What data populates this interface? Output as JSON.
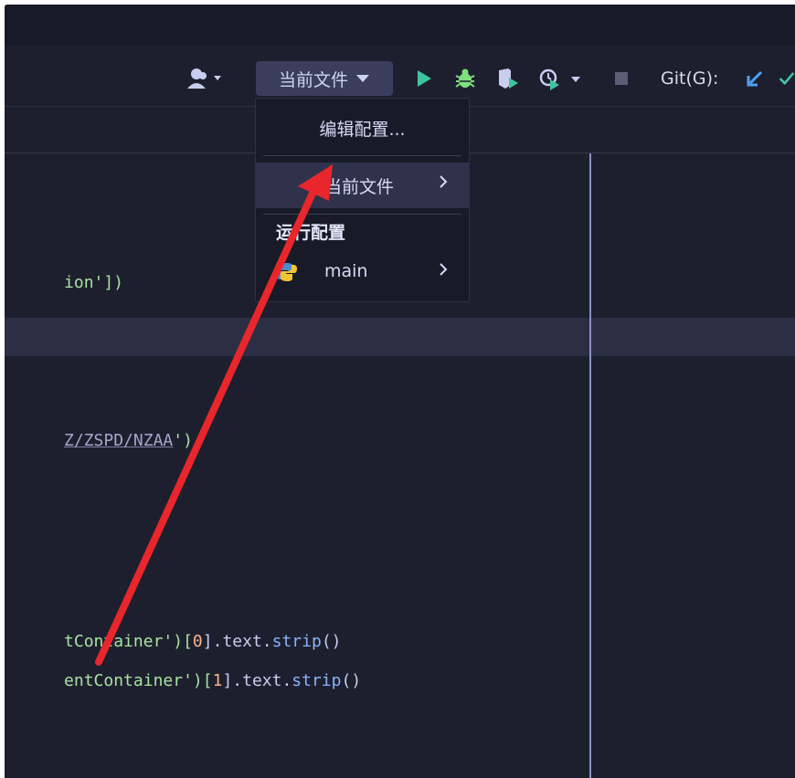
{
  "toolbar": {
    "run_config_label": "当前文件",
    "git_label": "Git(G):",
    "colors": {
      "run": "#40c4a0",
      "debug": "#7ee07e",
      "accent_blue": "#4ea2f5"
    }
  },
  "dropdown": {
    "edit_label": "编辑配置...",
    "current_file_label": "当前文件",
    "section_header": "运行配置",
    "main_label": "main"
  },
  "code": {
    "line1_tail": "ion'])",
    "line2_path": "Z/ZSPD/NZAA",
    "line2_tail": "')",
    "line3_a": "tContainer')[",
    "line3_num": "0",
    "line3_b": "].text.",
    "line3_fn": "strip",
    "line3_c": "()",
    "line4_a": "entContainer')[",
    "line4_num": "1",
    "line4_b": "].text.",
    "line4_fn": "strip",
    "line4_c": "()"
  },
  "annotation": {
    "arrow_color": "#e8262b"
  }
}
